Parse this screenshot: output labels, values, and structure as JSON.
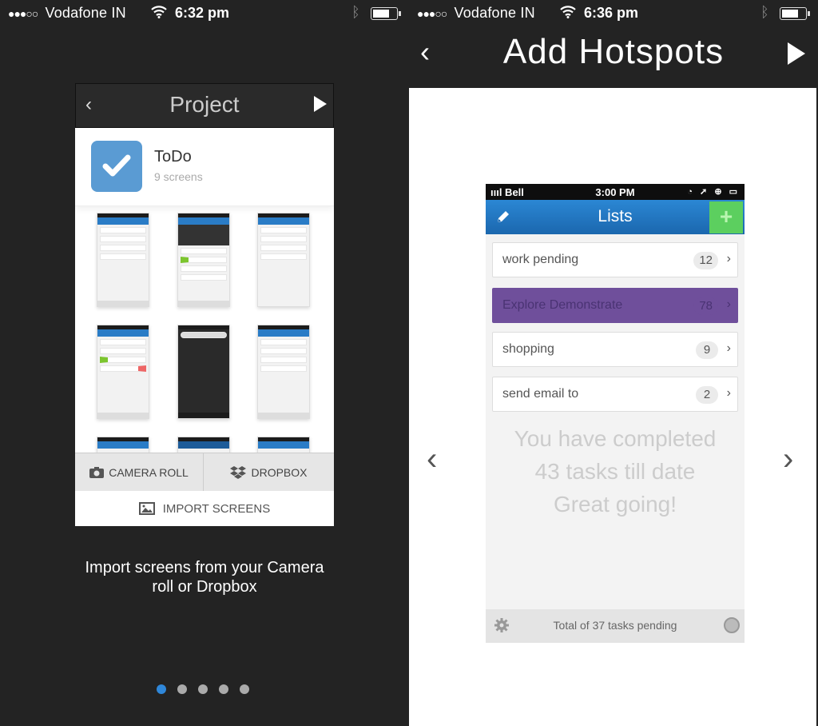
{
  "left": {
    "status": {
      "signal": "●●●○○",
      "carrier": "Vodafone IN",
      "time": "6:32 pm"
    },
    "mock": {
      "header_title": "Project",
      "back_icon": "‹",
      "project": {
        "name": "ToDo",
        "screens": "9 screens"
      },
      "import": {
        "camera_roll": "CAMERA ROLL",
        "dropbox": "DROPBOX",
        "import_screens": "IMPORT SCREENS"
      }
    },
    "caption": "Import screens from your Camera roll or Dropbox",
    "pager": {
      "count": 5,
      "active": 1
    }
  },
  "right": {
    "status": {
      "signal": "●●●○○",
      "carrier": "Vodafone IN",
      "time": "6:36 pm"
    },
    "header": {
      "title": "Add Hotspots",
      "back": "‹"
    },
    "nav": {
      "prev": "‹",
      "next": "›"
    },
    "phone": {
      "status": {
        "carrier": "ıııl Bell",
        "time": "3:00 PM",
        "icons": "◔ ➚ ⊕ ▭"
      },
      "nav_title": "Lists",
      "add_label": "+",
      "lists": [
        {
          "label": "work pending",
          "count": "12"
        },
        {
          "label": "Explore Demonstrate",
          "count": "78",
          "highlight": true
        },
        {
          "label": "shopping",
          "count": "9"
        },
        {
          "label": "send email to",
          "count": "2"
        }
      ],
      "completed": [
        "You have completed",
        "43 tasks till date",
        "Great going!"
      ],
      "footer": "Total of 37 tasks pending"
    }
  },
  "colors": {
    "accent_blue": "#2f87d9",
    "hotspot_purple": "#6f4f9b",
    "add_green": "#5ccf5f",
    "app_bar": "#2b87d4"
  }
}
